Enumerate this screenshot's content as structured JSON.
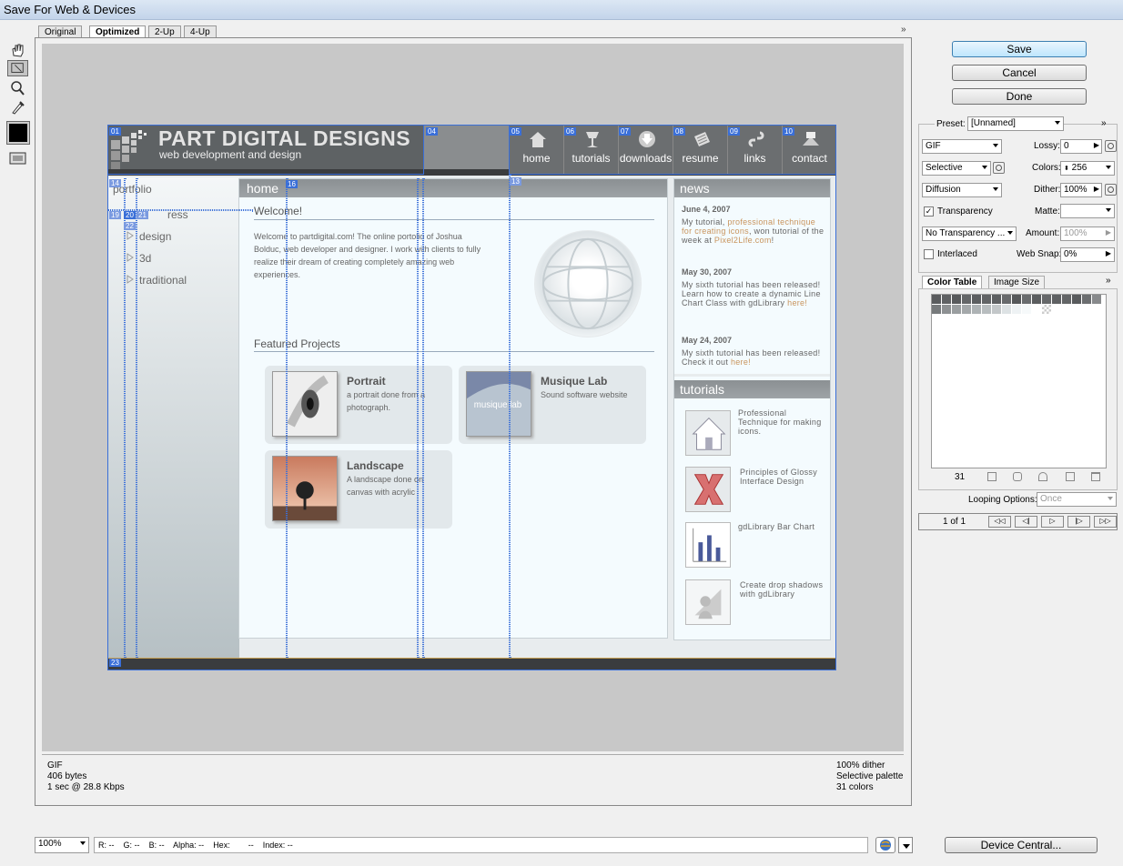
{
  "window": {
    "title": "Save For Web & Devices"
  },
  "view_tabs": [
    "Original",
    "Optimized",
    "2-Up",
    "4-Up"
  ],
  "active_tab": "Optimized",
  "tools": [
    "hand-tool",
    "slice-select-tool",
    "zoom-tool",
    "eyedropper-tool",
    "eyedropper-color",
    "toggle-slices-visibility"
  ],
  "site": {
    "logo_title": "PART DIGITAL DESIGNS",
    "logo_subtitle": "web development and design",
    "nav": [
      "home",
      "tutorials",
      "downloads",
      "resume",
      "links",
      "contact"
    ],
    "left_title": "portfolio",
    "left_items": [
      "ress",
      "design",
      "3d",
      "traditional"
    ],
    "main_header": "home",
    "welcome": "Welcome!",
    "intro": "Welcome to partdigital.com! The online portolio of Joshua Bolduc, web developer and designer. I work with clients to fully realize their dream of creating completely amazing web experiences.",
    "featured": "Featured Projects",
    "projects": [
      {
        "title": "Portrait",
        "desc": "a portrait done from a photograph."
      },
      {
        "title": "Musique Lab",
        "desc": "Sound software website"
      },
      {
        "title": "Landscape",
        "desc": "A landscape done on canvas with acrylic"
      }
    ],
    "musique_thumb": "musique lab",
    "news_header": "news",
    "news": [
      {
        "date": "June 4, 2007",
        "pre": "My tutorial, ",
        "link": "professional technique for creating icons",
        "mid": ", won tutorial of the week at ",
        "link2": "Pixel2Life.com",
        "post": "!"
      },
      {
        "date": "May 30, 2007",
        "pre": "My sixth tutorial has been released! Learn how to create a dynamic Line Chart Class with gdLibrary ",
        "link": "here!"
      },
      {
        "date": "May 24, 2007",
        "pre": "My sixth tutorial has been released! Check it out ",
        "link": "here!"
      }
    ],
    "tutorials_header": "tutorials",
    "tutorials": [
      "Professional Technique for making icons.",
      "Principles of Glossy Interface Design",
      "gdLibrary Bar Chart",
      "Create drop shadows with gdLibrary"
    ],
    "slices": [
      "01",
      "04",
      "05",
      "06",
      "07",
      "08",
      "09",
      "10",
      "13",
      "14",
      "16",
      "19",
      "20",
      "21",
      "22",
      "23"
    ]
  },
  "info": {
    "format": "GIF",
    "size": "406 bytes",
    "speed": "1 sec @ 28.8 Kbps",
    "dither": "100% dither",
    "palette": "Selective palette",
    "colors": "31 colors"
  },
  "buttons": {
    "save": "Save",
    "cancel": "Cancel",
    "done": "Done",
    "device_central": "Device Central..."
  },
  "settings": {
    "preset_label": "Preset:",
    "preset": "[Unnamed]",
    "format": "GIF",
    "lossy_label": "Lossy:",
    "lossy": "0",
    "reduction": "Selective",
    "colors_label": "Colors:",
    "colors": "256",
    "dither_algo": "Diffusion",
    "dither_label": "Dither:",
    "dither": "100%",
    "transparency_label": "Transparency",
    "transparency_checked": true,
    "matte_label": "Matte:",
    "transparency_dither": "No Transparency ...",
    "amount_label": "Amount:",
    "amount": "100%",
    "interlaced_label": "Interlaced",
    "interlaced_checked": false,
    "websnap_label": "Web Snap:",
    "websnap": "0%"
  },
  "color_panel": {
    "tabs": [
      "Color Table",
      "Image Size"
    ],
    "active_tab": "Color Table",
    "count": "31",
    "swatches": [
      "#5a5c5e",
      "#606264",
      "#585a5c",
      "#646668",
      "#5c5e60",
      "#626466",
      "#5e6062",
      "#686a6c",
      "#56585a",
      "#6a6c6e",
      "#5b5d5f",
      "#66686a",
      "#5f6163",
      "#636567",
      "#595b5d",
      "#6c6e70",
      "#888a8c",
      "#777a7c",
      "#8e9193",
      "#9a9ea0",
      "#a4a8aa",
      "#aeb3b5",
      "#b8bdbf",
      "#c3c7c9",
      "#dde2e4",
      "#eef2f4",
      "#f6f9fa",
      "#ffffff"
    ],
    "looping_label": "Looping Options:",
    "looping": "Once",
    "frame": "1 of 1"
  },
  "statusbar": {
    "zoom": "100%",
    "r_label": "R:",
    "r": "--",
    "g_label": "G:",
    "g": "--",
    "b_label": "B:",
    "b": "--",
    "alpha_label": "Alpha:",
    "alpha": "--",
    "hex_label": "Hex:",
    "hex": "--",
    "index_label": "Index:",
    "index": "--"
  },
  "colors": {
    "slice_blue": "#3a6fd8",
    "accent_link": "#c9955e"
  }
}
